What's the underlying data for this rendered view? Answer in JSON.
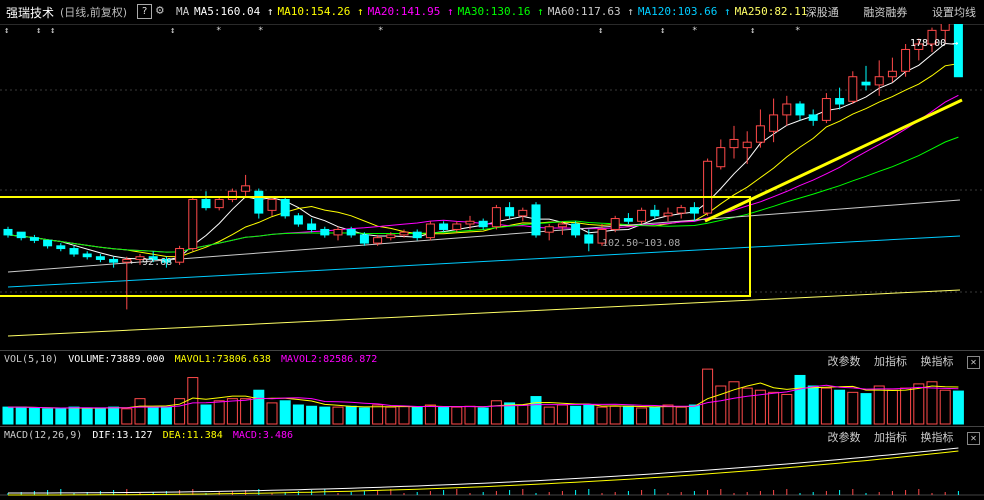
{
  "header": {
    "title": "强瑞技术",
    "mode": "(日线,前复权)",
    "help": "?",
    "ma_label": "MA",
    "ma": [
      {
        "label": "MA5:160.04",
        "color": "#ffffff"
      },
      {
        "label": "MA10:154.26",
        "color": "#ffff00"
      },
      {
        "label": "MA20:141.95",
        "color": "#ff00ff"
      },
      {
        "label": "MA30:130.16",
        "color": "#00ff00"
      },
      {
        "label": "MA60:117.63",
        "color": "#cccccc"
      },
      {
        "label": "MA120:103.66",
        "color": "#00ccff"
      },
      {
        "label": "MA250:82.11",
        "color": "#ffff66"
      }
    ],
    "links": [
      "深股通",
      "融资融券",
      "设置均线"
    ]
  },
  "main": {
    "high_label": "178.00",
    "low_label": "92.68",
    "mid_label": "102.50~103.08"
  },
  "vol": {
    "name": "VOL(5,10)",
    "volume": "VOLUME:73889.000",
    "mavol1": "MAVOL1:73806.638",
    "mavol2": "MAVOL2:82586.872"
  },
  "macd": {
    "name": "MACD(12,26,9)",
    "dif": "DIF:13.127",
    "dea": "DEA:11.384",
    "macd": "MACD:3.486"
  },
  "panel_buttons": [
    "改参数",
    "加指标",
    "换指标"
  ],
  "chart_data": {
    "type": "candlestick",
    "candles": [
      [
        122,
        123,
        119,
        120
      ],
      [
        121,
        121,
        118,
        119
      ],
      [
        119,
        120,
        117,
        118
      ],
      [
        118,
        118,
        115,
        116
      ],
      [
        116,
        117,
        114,
        115
      ],
      [
        115,
        116,
        112,
        113
      ],
      [
        113,
        114,
        111,
        112
      ],
      [
        112,
        113,
        110,
        111
      ],
      [
        111,
        112,
        108,
        110
      ],
      [
        110,
        112,
        92.68,
        111
      ],
      [
        111,
        113,
        109,
        112
      ],
      [
        112,
        114,
        110,
        111
      ],
      [
        111,
        112,
        108,
        110
      ],
      [
        110,
        116,
        109,
        115
      ],
      [
        115,
        134,
        114,
        133
      ],
      [
        133,
        136,
        129,
        130
      ],
      [
        130,
        134,
        129,
        133
      ],
      [
        133,
        137,
        132,
        136
      ],
      [
        136,
        142,
        134,
        138
      ],
      [
        136,
        137,
        126,
        128
      ],
      [
        129,
        134,
        127,
        133
      ],
      [
        133,
        134,
        126,
        127
      ],
      [
        127,
        128,
        123,
        124
      ],
      [
        124,
        126,
        121,
        122
      ],
      [
        122,
        123,
        119,
        120
      ],
      [
        120,
        123,
        118,
        122
      ],
      [
        122,
        123,
        119,
        120
      ],
      [
        120,
        121,
        116,
        117
      ],
      [
        117,
        120,
        116,
        119
      ],
      [
        119,
        121,
        118,
        120
      ],
      [
        120,
        122,
        119,
        121
      ],
      [
        121,
        122,
        118,
        119
      ],
      [
        119,
        125,
        118,
        124
      ],
      [
        124,
        125,
        121,
        122
      ],
      [
        122,
        125,
        121,
        124
      ],
      [
        124,
        127,
        122,
        125
      ],
      [
        125,
        126,
        122,
        123
      ],
      [
        123,
        131,
        122,
        130
      ],
      [
        130,
        132,
        126,
        127
      ],
      [
        127,
        130,
        125,
        129
      ],
      [
        131,
        132,
        119,
        120
      ],
      [
        121,
        124,
        118,
        123
      ],
      [
        123,
        125,
        120,
        124
      ],
      [
        124,
        125,
        119,
        120
      ],
      [
        120,
        122,
        114,
        117
      ],
      [
        117,
        124,
        116,
        122
      ],
      [
        122,
        127,
        121,
        126
      ],
      [
        126,
        128,
        124,
        125
      ],
      [
        125,
        130,
        124,
        129
      ],
      [
        129,
        131,
        126,
        127
      ],
      [
        127,
        130,
        125,
        128
      ],
      [
        128,
        131,
        126,
        130
      ],
      [
        130,
        132,
        125,
        128
      ],
      [
        128,
        148,
        127,
        147
      ],
      [
        145,
        155,
        144,
        152
      ],
      [
        152,
        160,
        148,
        155
      ],
      [
        152,
        158,
        146,
        154
      ],
      [
        154,
        166,
        152,
        160
      ],
      [
        158,
        170,
        154,
        164
      ],
      [
        164,
        171,
        160,
        168
      ],
      [
        168,
        169,
        162,
        164
      ],
      [
        164,
        166,
        160,
        162
      ],
      [
        162,
        172,
        161,
        170
      ],
      [
        170,
        174,
        166,
        168
      ],
      [
        169,
        180,
        168,
        178
      ],
      [
        176,
        182,
        173,
        175
      ],
      [
        175,
        184,
        171,
        178
      ],
      [
        178,
        185,
        176,
        180
      ],
      [
        180,
        190,
        178,
        188
      ],
      [
        188,
        192,
        184,
        190
      ],
      [
        190,
        196,
        187,
        195
      ],
      [
        195,
        200,
        190,
        198
      ],
      [
        198,
        196,
        178,
        178
      ]
    ],
    "volume": [
      40,
      40,
      38,
      36,
      36,
      40,
      38,
      38,
      40,
      36,
      60,
      38,
      40,
      60,
      110,
      45,
      55,
      60,
      60,
      80,
      50,
      55,
      45,
      42,
      40,
      40,
      42,
      38,
      45,
      40,
      42,
      40,
      45,
      40,
      40,
      42,
      38,
      55,
      50,
      45,
      65,
      40,
      45,
      42,
      45,
      40,
      42,
      42,
      38,
      40,
      45,
      40,
      45,
      130,
      90,
      100,
      85,
      80,
      75,
      70,
      115,
      90,
      85,
      80,
      75,
      72,
      90,
      80,
      85,
      95,
      100,
      80,
      78
    ],
    "title": "强瑞技术"
  }
}
